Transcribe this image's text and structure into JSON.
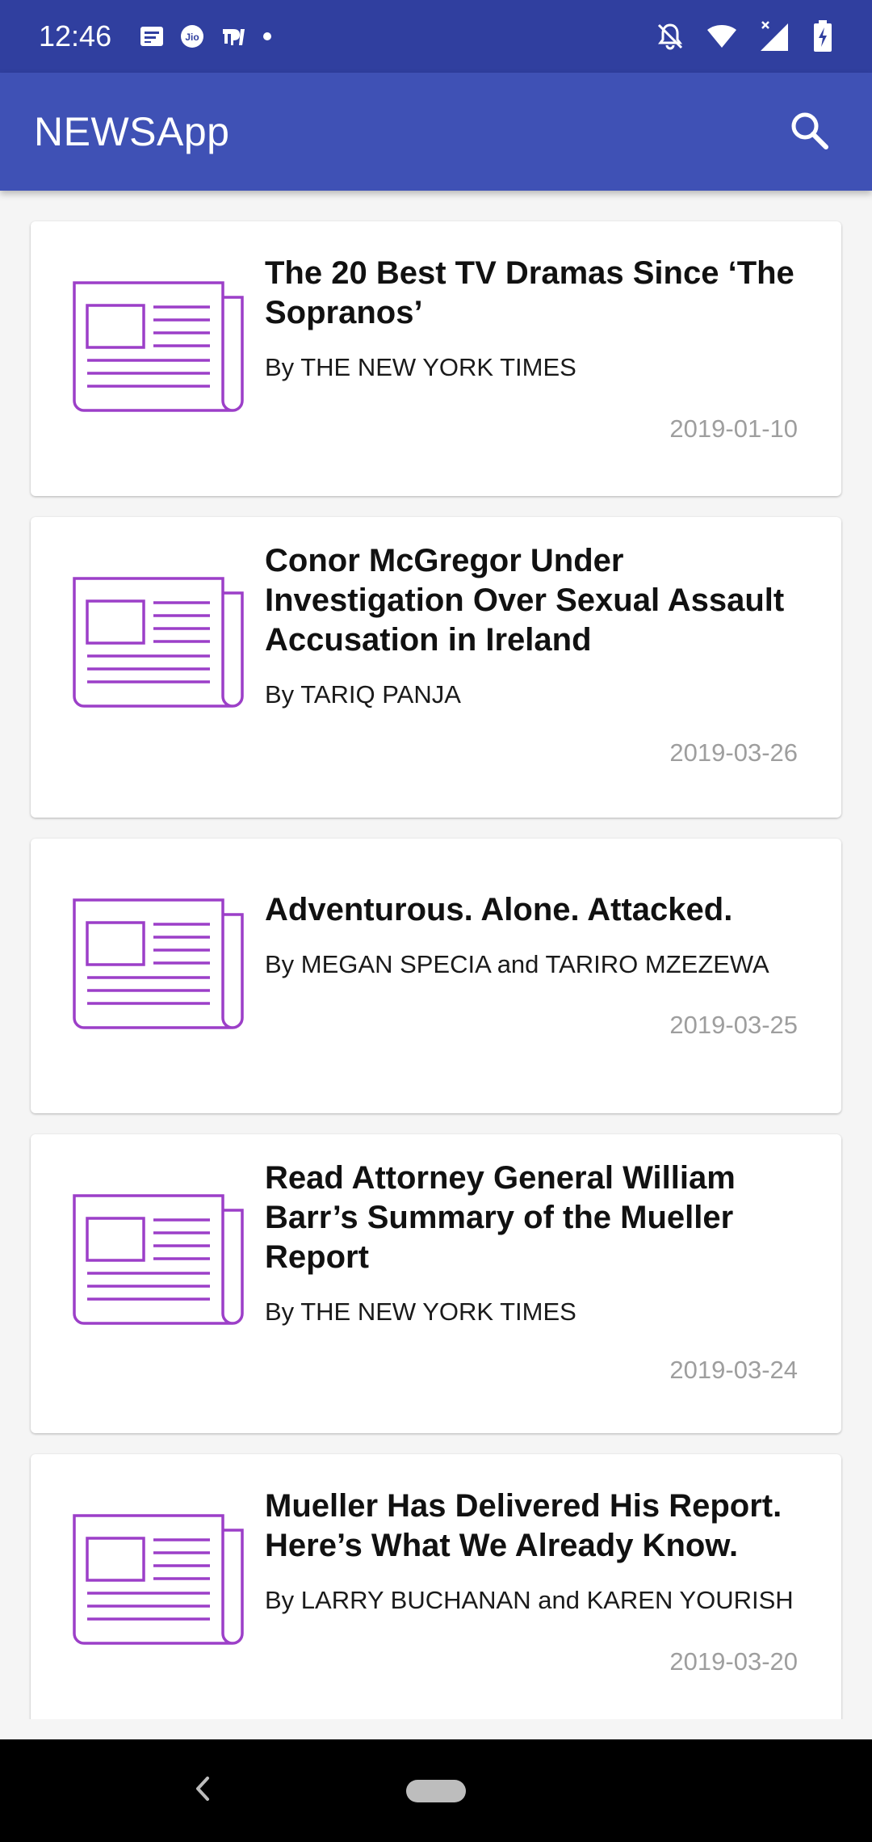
{
  "status_bar": {
    "time": "12:46",
    "left_icons": [
      "message-icon",
      "jio-icon",
      "paytm-icon",
      "dot-icon"
    ],
    "right_icons": [
      "notifications-off-icon",
      "wifi-icon",
      "signal-icon",
      "battery-charging-icon"
    ]
  },
  "app_bar": {
    "title": "NEWSApp",
    "search_icon": "search-icon"
  },
  "articles": [
    {
      "title": "The 20 Best TV Dramas Since ‘The Sopranos’",
      "byline": "By THE NEW YORK TIMES",
      "date": "2019-01-10"
    },
    {
      "title": "Conor McGregor Under Investigation Over Sexual Assault Accusation in Ireland",
      "byline": "By TARIQ PANJA",
      "date": "2019-03-26"
    },
    {
      "title": "Adventurous. Alone. Attacked.",
      "byline": "By MEGAN SPECIA and TARIRO MZEZEWA",
      "date": "2019-03-25"
    },
    {
      "title": "Read Attorney General William Barr’s Summary of the Mueller Report",
      "byline": "By THE NEW YORK TIMES",
      "date": "2019-03-24"
    },
    {
      "title": "Mueller Has Delivered His Report. Here’s What We Already Know.",
      "byline": "By LARRY BUCHANAN and KAREN YOURISH",
      "date": "2019-03-20"
    }
  ],
  "colors": {
    "status_bar": "#303f9f",
    "app_bar": "#3f51b5",
    "icon_accent": "#9c3fc8",
    "date_text": "#9e9e9e"
  },
  "nav_bar": {
    "back_icon": "back-chevron-icon",
    "home_icon": "home-pill-icon"
  }
}
